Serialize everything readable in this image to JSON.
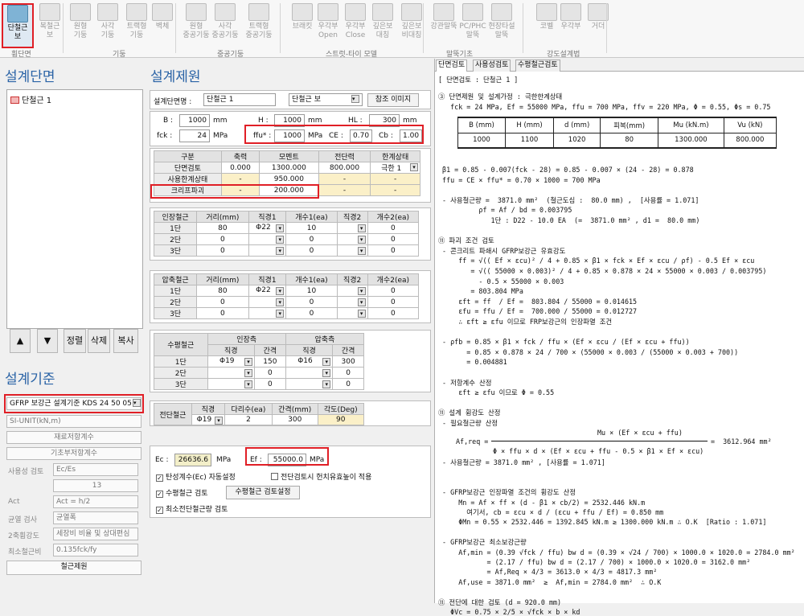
{
  "ribbon": {
    "buttons": [
      {
        "label1": "단철근",
        "label2": "보"
      },
      {
        "label1": "복철근",
        "label2": "보"
      },
      {
        "label1": "원형",
        "label2": "기둥"
      },
      {
        "label1": "사각",
        "label2": "기둥"
      },
      {
        "label1": "트랙형",
        "label2": "기둥"
      },
      {
        "label1": "벽체",
        "label2": ""
      },
      {
        "label1": "원형",
        "label2": "중공기둥"
      },
      {
        "label1": "사각",
        "label2": "중공기둥"
      },
      {
        "label1": "트랙형",
        "label2": "중공기둥"
      },
      {
        "label1": "브래킷",
        "label2": ""
      },
      {
        "label1": "우각부",
        "label2": "Open"
      },
      {
        "label1": "우각부",
        "label2": "Close"
      },
      {
        "label1": "깊은보",
        "label2": "대칭"
      },
      {
        "label1": "깊은보",
        "label2": "비대칭"
      },
      {
        "label1": "강관말뚝",
        "label2": ""
      },
      {
        "label1": "PC/PHC",
        "label2": "말뚝"
      },
      {
        "label1": "현장타설",
        "label2": "말뚝"
      },
      {
        "label1": "코벨",
        "label2": ""
      },
      {
        "label1": "우각부",
        "label2": ""
      },
      {
        "label1": "거더",
        "label2": ""
      }
    ],
    "groups": [
      "휨단면",
      "기둥",
      "중공기둥",
      "스트럿-타이 모델",
      "말뚝기초",
      "강도설계법"
    ]
  },
  "left": {
    "section_title": "설계단면",
    "tree_item": "단철근 1",
    "tree_buttons": [
      "▲",
      "▼",
      "정렬",
      "삭제",
      "복사"
    ],
    "criteria_title": "설계기준",
    "criteria_select": "GFRP 보강근 설계기준 KDS 24 50 05",
    "unit_select": "SI-UNIT(kN,m)",
    "btn_material": "재료저항계수",
    "btn_base": "기초부저항계수",
    "usability_label": "사용성 검토",
    "usability_value": "Ec/Es",
    "usability_num": "13",
    "act_label": "Act",
    "act_value": "Act = h/2",
    "crack_label": "균열 검사",
    "crack_value": "균열폭",
    "dir_label": "2축휨강도",
    "dir_value": "세장비 비율 및 상대편심",
    "min_label": "최소철근비",
    "min_value": "0.135fck/fy",
    "btn_rebar": "철근제원"
  },
  "mid": {
    "title": "설계제원",
    "name_label": "설계단면명 :",
    "name_value": "단철근 1",
    "type_value": "단철근 보",
    "ref_btn": "참조 이미지",
    "B_label": "B :",
    "B": "1000",
    "B_unit": "mm",
    "H_label": "H :",
    "H": "1000",
    "H_unit": "mm",
    "HL_label": "HL :",
    "HL": "300",
    "HL_unit": "mm",
    "fck_label": "fck :",
    "fck": "24",
    "fck_unit": "MPa",
    "ffu_label": "ffu* :",
    "ffu": "1000",
    "ffu_unit": "MPa",
    "CE_label": "CE :",
    "CE": "0.70",
    "Cb_label": "Cb :",
    "Cb": "1.00",
    "force_head": [
      "구분",
      "축력",
      "모멘트",
      "전단력",
      "한계상태"
    ],
    "force_rows": [
      [
        "단면검토",
        "0.000",
        "1300.000",
        "800.000",
        "극한 1"
      ],
      [
        "사용한계상태",
        "-",
        "950.000",
        "-",
        "-"
      ],
      [
        "크리프파괴",
        "-",
        "200.000",
        "-",
        "-"
      ]
    ],
    "tension_head": [
      "인장철근",
      "거리(mm)",
      "직경1",
      "개수1(ea)",
      "직경2",
      "개수2(ea)"
    ],
    "tension_rows": [
      [
        "1단",
        "80",
        "Φ22",
        "10",
        "",
        "0"
      ],
      [
        "2단",
        "0",
        "",
        "0",
        "",
        "0"
      ],
      [
        "3단",
        "0",
        "",
        "0",
        "",
        "0"
      ]
    ],
    "comp_head": [
      "압축철근",
      "거리(mm)",
      "직경1",
      "개수1(ea)",
      "직경2",
      "개수2(ea)"
    ],
    "comp_rows": [
      [
        "1단",
        "80",
        "Φ22",
        "10",
        "",
        "0"
      ],
      [
        "2단",
        "0",
        "",
        "0",
        "",
        "0"
      ],
      [
        "3단",
        "0",
        "",
        "0",
        "",
        "0"
      ]
    ],
    "horiz_label": "수평철근",
    "horiz_sub": [
      "인장측",
      "압축측"
    ],
    "horiz_head": [
      "직경",
      "간격",
      "직경",
      "간격"
    ],
    "horiz_rows": [
      [
        "1단",
        "Φ19",
        "150",
        "Φ16",
        "300"
      ],
      [
        "2단",
        "",
        "0",
        "",
        "0"
      ],
      [
        "3단",
        "",
        "0",
        "",
        "0"
      ]
    ],
    "shear_label": "전단철근",
    "shear_head": [
      "직경",
      "다리수(ea)",
      "간격(mm)",
      "각도(Deg)"
    ],
    "shear_row": [
      "Φ19",
      "2",
      "300",
      "90"
    ],
    "Ec_label": "Ec :",
    "Ec": "26636.6",
    "Ec_unit": "MPa",
    "Ef_label": "Ef :",
    "Ef": "55000.0",
    "Ef_unit": "MPa",
    "chk_elastic": "탄성계수(Ec) 자동설정",
    "chk_shear": "전단검토시 헌치유효높이 적용",
    "chk_horiz": "수평철근 검토",
    "btn_horiz": "수평철근 검토설정",
    "chk_min_shear": "최소전단철근량 검토"
  },
  "right": {
    "tabs": [
      "단면검토",
      "사용성검토",
      "수평철근검토"
    ],
    "header": "[ 단면검토 : 단철근 1 ]",
    "table_head": [
      "B (mm)",
      "H (mm)",
      "d (mm)",
      "피복(mm)",
      "Mu (kN.m)",
      "Vu (kN)"
    ],
    "table_vals": [
      "1000",
      "1100",
      "1020",
      "80",
      "1300.000",
      "800.000"
    ],
    "lines_a": [
      "③ 단면제원 및 설계가정 : 극한한계상태",
      "   fck = 24 MPa, Ef = 55000 MPa, ffu = 700 MPa, ffv = 220 MPa, Φ = 0.55, Φs = 0.75"
    ],
    "lines_b": [
      " β1 = 0.85 - 0.007(fck - 28) = 0.85 - 0.007 × (24 - 28) = 0.878",
      " ffu = CE × ffu* = 0.70 × 1000 = 700 MPa",
      "",
      " - 사용철근량 =  3871.0 mm²  (철근도심 :  80.0 mm) ,  [사용률 = 1.071]",
      "          ρf = Af / bd = 0.003795",
      "             1단 : D22 - 10.0 EA  (=  3871.0 mm² , d1 =  80.0 mm)",
      "",
      "⑪ 파괴 조건 검토",
      " - 콘크리트 파쇄시 GFRP보강근 유효강도",
      "     ff = √(( Ef × εcu)² / 4 + 0.85 × β1 × fck × Ef × εcu / ρf) - 0.5 Ef × εcu",
      "        = √(( 55000 × 0.003)² / 4 + 0.85 × 0.878 × 24 × 55000 × 0.003 / 0.003795)",
      "          - 0.5 × 55000 × 0.003",
      "        = 803.804 MPa",
      "     εft = ff  / Ef =  803.804 / 55000 = 0.014615",
      "     εfu = ffu / Ef =  700.000 / 55000 = 0.012727",
      "     ∴ εft ≥ εfu 이므로 FRP보강근의 인장파열 조건",
      "",
      " - ρfb = 0.85 × β1 × fck / ffu × (Ef × εcu / (Ef × εcu + ffu))",
      "       = 0.85 × 0.878 × 24 / 700 × (55000 × 0.003 / (55000 × 0.003 + 700))",
      "       = 0.004881",
      "",
      " - 저항계수 산정",
      "     εft ≥ εfu 이므로 Φ = 0.55",
      "",
      "⑪ 설계 휨강도 산정",
      " - 필요철근량 산정"
    ],
    "formula_num": "Mu × (Ef × εcu + ffu)",
    "formula_left": "Af,req =",
    "formula_den": "Φ × ffu × d × (Ef × εcu + ffu - 0.5 × β1 × Ef × εcu)",
    "formula_res": "=  3612.964 mm²",
    "lines_c": [
      " - 사용철근량 = 3871.0 mm² , [사용률 = 1.071]",
      "",
      "",
      " - GFRP보강근 인장파열 조건의 휨강도 산정",
      "     Mn = Af × ff × (d - β1 × cb/2) = 2532.446 kN.m",
      "       여기서, cb = εcu × d / (εcu + ffu / Ef) = 0.850 mm",
      "     ΦMn = 0.55 × 2532.446 = 1392.845 kN.m ≥ 1300.000 kN.m ∴ O.K  [Ratio : 1.071]",
      "",
      " - GFRP보강근 최소보강근량",
      "     Af,min = (0.39 √fck / ffu) bw d = (0.39 × √24 / 700) × 1000.0 × 1020.0 = 2784.0 mm²",
      "            = (2.17 / ffu) bw d = (2.17 / 700) × 1000.0 × 1020.0 = 3162.0 mm²",
      "            = Af,Req × 4/3 = 3613.0 × 4/3 = 4817.3 mm²",
      "     Af,use = 3871.0 mm²  ≥  Af,min = 2784.0 mm²  ∴ O.K",
      "",
      "⑪ 전단에 대한 검토 (d = 920.0 mm)",
      "   ΦVc = 0.75 × 2/5 × √fck × b × kd"
    ]
  }
}
